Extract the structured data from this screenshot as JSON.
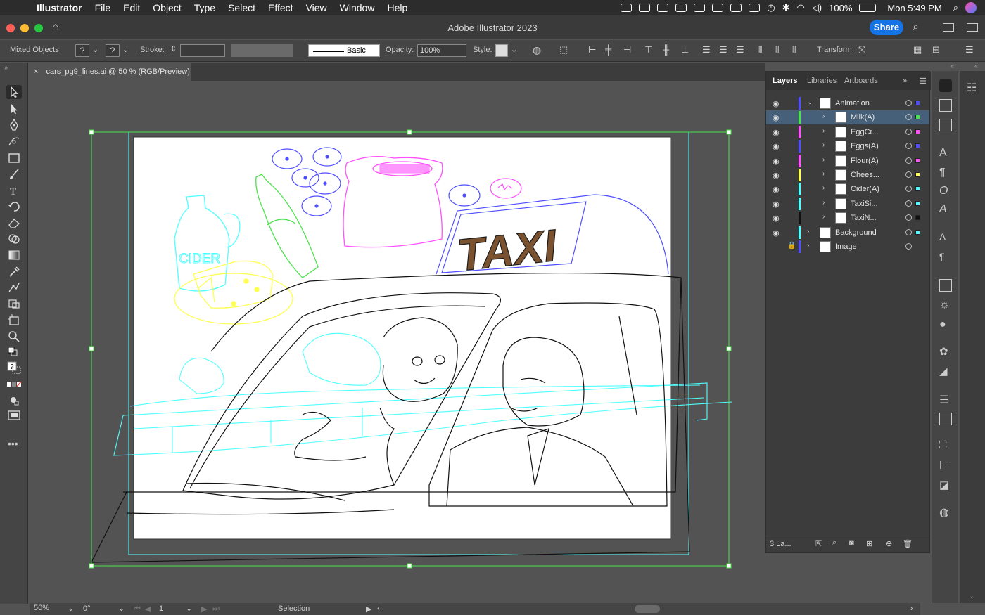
{
  "menubar": {
    "app": "Illustrator",
    "items": [
      "File",
      "Edit",
      "Object",
      "Type",
      "Select",
      "Effect",
      "View",
      "Window",
      "Help"
    ],
    "battery": "100%",
    "clock": "Mon 5:49 PM"
  },
  "window": {
    "title": "Adobe Illustrator 2023",
    "share_label": "Share"
  },
  "control": {
    "selection_label": "Mixed Objects",
    "fill_q": "?",
    "stroke_q": "?",
    "stroke_label": "Stroke:",
    "brush_label": "Basic",
    "opacity_label": "Opacity:",
    "opacity_value": "100%",
    "style_label": "Style:",
    "transform_label": "Transform"
  },
  "document": {
    "tab_title": "cars_pg9_lines.ai @ 50 % (RGB/Preview)"
  },
  "artwork": {
    "taxi_text": "TAXI",
    "cider_text": "CIDER"
  },
  "layers_panel": {
    "tabs": [
      "Layers",
      "Libraries",
      "Artboards"
    ],
    "rows": [
      {
        "name": "Animation",
        "color": "#4f4fff",
        "selected": false,
        "indent": 0,
        "locked": false,
        "square": "#4f4fff"
      },
      {
        "name": "Milk(A)",
        "color": "#4be34b",
        "selected": true,
        "indent": 1,
        "locked": false,
        "square": "#4be34b"
      },
      {
        "name": "EggCr...",
        "color": "#ff4fff",
        "selected": false,
        "indent": 1,
        "locked": false,
        "square": "#ff4fff"
      },
      {
        "name": "Eggs(A)",
        "color": "#4f4fff",
        "selected": false,
        "indent": 1,
        "locked": false,
        "square": "#4f4fff"
      },
      {
        "name": "Flour(A)",
        "color": "#ff4fff",
        "selected": false,
        "indent": 1,
        "locked": false,
        "square": "#ff4fff"
      },
      {
        "name": "Chees...",
        "color": "#ffff4f",
        "selected": false,
        "indent": 1,
        "locked": false,
        "square": "#ffff4f"
      },
      {
        "name": "Cider(A)",
        "color": "#4fffff",
        "selected": false,
        "indent": 1,
        "locked": false,
        "square": "#4fffff"
      },
      {
        "name": "TaxiSi...",
        "color": "#4fffff",
        "selected": false,
        "indent": 1,
        "locked": false,
        "square": "#4fffff"
      },
      {
        "name": "TaxiN...",
        "color": "#111111",
        "selected": false,
        "indent": 1,
        "locked": false,
        "square": "#111111"
      },
      {
        "name": "Background",
        "color": "#4fffff",
        "selected": false,
        "indent": 0,
        "locked": false,
        "square": "#4fffff"
      },
      {
        "name": "Image",
        "color": "#4f4fff",
        "selected": false,
        "indent": 0,
        "locked": true,
        "square": ""
      }
    ],
    "footer_count": "3 La..."
  },
  "status": {
    "zoom": "50%",
    "rotation": "0°",
    "artboard": "1",
    "tool": "Selection"
  },
  "colors": {
    "accent": "#1473e6",
    "selection_bounds": "#4be34b"
  }
}
